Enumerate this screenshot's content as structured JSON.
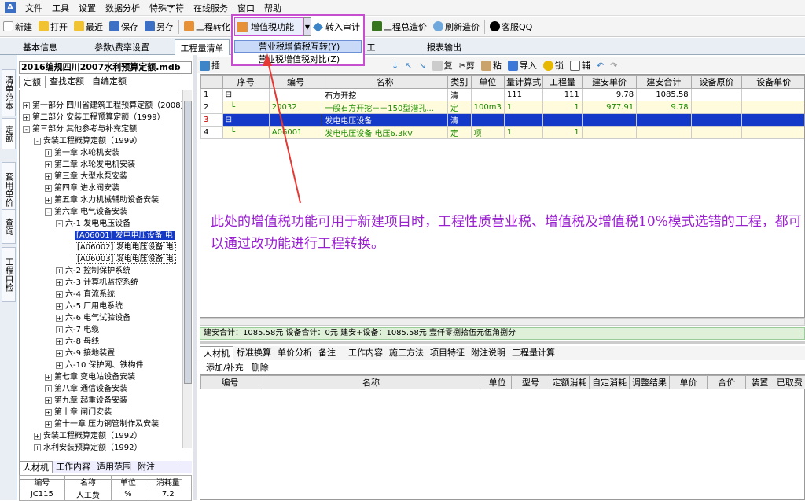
{
  "menu": [
    "文件",
    "工具",
    "设置",
    "数据分析",
    "特殊字符",
    "在线服务",
    "窗口",
    "帮助"
  ],
  "toolbar": [
    "新建",
    "打开",
    "最近",
    "保存",
    "另存",
    "工程转化",
    "增值税功能",
    "转入审计",
    "工程总造价",
    "刷新造价",
    "客服QQ"
  ],
  "dropdown": {
    "main": "增值税功能",
    "items": [
      "营业税增值税互转(Y)",
      "营业税增值税对比(Z)"
    ]
  },
  "main_tabs": [
    "基本信息",
    "参数\\费率设置",
    "工程量清单",
    "工",
    "报表输出"
  ],
  "vtabs": [
    "清单范本",
    "定额",
    "套用单价",
    "查询",
    "工程自检"
  ],
  "left": {
    "title": "2016编规四川2007水利预算定额.mdb",
    "tabs": [
      "定额",
      "查找定额",
      "自编定额"
    ],
    "tree": [
      "第一部分 四川省建筑工程预算定额（2008）",
      "第二部分 安装工程预算定额（1999）",
      "第三部分 其他参考与补充定额",
      "安装工程概算定额（1999）",
      "第一章 水轮机安装",
      "第二章 水轮发电机安装",
      "第三章 大型水泵安装",
      "第四章 进水阀安装",
      "第五章 水力机械辅助设备安装",
      "第六章 电气设备安装",
      "六-1 发电电压设备",
      "[A06001] 发电电压设备 电",
      "[A06002] 发电电压设备 电",
      "[A06003] 发电电压设备 电",
      "六-2 控制保护系统",
      "六-3 计算机监控系统",
      "六-4 直流系统",
      "六-5 厂用电系统",
      "六-6 电气试验设备",
      "六-7 电缆",
      "六-8 母线",
      "六-9 接地装置",
      "六-10 保护网、铁构件",
      "第七章 变电站设备安装",
      "第八章 通信设备安装",
      "第九章 起重设备安装",
      "第十章 闸门安装",
      "第十一章 压力钢管制作及安装",
      "安装工程概算定额（1992）",
      "水利安装预算定额（1992）"
    ],
    "bottom_tabs": [
      "人材机",
      "工作内容",
      "适用范围",
      "附注"
    ],
    "mini_headers": [
      "编号",
      "名称",
      "单位",
      "消耗量"
    ],
    "mini_row": [
      "JC115",
      "人工费",
      "%",
      "7.2"
    ]
  },
  "grid": {
    "headers": [
      "",
      "序号",
      "编号",
      "名称",
      "类别",
      "单位",
      "量计算式",
      "工程量",
      "建安单价",
      "建安合计",
      "设备原价",
      "设备单价"
    ],
    "rows": [
      [
        "1",
        "",
        "",
        "石方开挖",
        "清",
        "",
        "111",
        "111",
        "9.78",
        "1085.58",
        "",
        ""
      ],
      [
        "2",
        "",
        "20032",
        "一般石方开挖－－150型潜孔...",
        "定",
        "100m3",
        "1",
        "1",
        "977.91",
        "9.78",
        "",
        ""
      ],
      [
        "3",
        "",
        "",
        "发电电压设备",
        "清",
        "",
        "",
        "",
        "",
        "",
        "",
        ""
      ],
      [
        "4",
        "",
        "A06001",
        "发电电压设备 电压6.3kV",
        "定",
        "项",
        "1",
        "1",
        "",
        "",
        "",
        ""
      ]
    ]
  },
  "grid_toolbar": [
    "插",
    "复",
    "剪",
    "粘",
    "导入",
    "锁",
    "辅"
  ],
  "summary": "建安合计：1085.58元  设备合计：0元  建安+设备：1085.58元  壹仟零捌拾伍元伍角捌分",
  "bottom_tabs": [
    "人材机",
    "标准换算",
    "单价分析",
    "备注",
    "工作内容",
    "施工方法",
    "项目特征",
    "附注说明",
    "工程量计算"
  ],
  "bottom_toolbar": [
    "添加/补充",
    "删除"
  ],
  "bottom_headers": [
    "编号",
    "名称",
    "单位",
    "型号",
    "定额消耗",
    "自定消耗",
    "调整结果",
    "单价",
    "合价",
    "装置",
    "已取费"
  ],
  "callout": "此处的增值税功能可用于新建项目时，工程性质营业税、增值税及增值税10%模式选错的工程，都可以通过改功能进行工程转换。"
}
